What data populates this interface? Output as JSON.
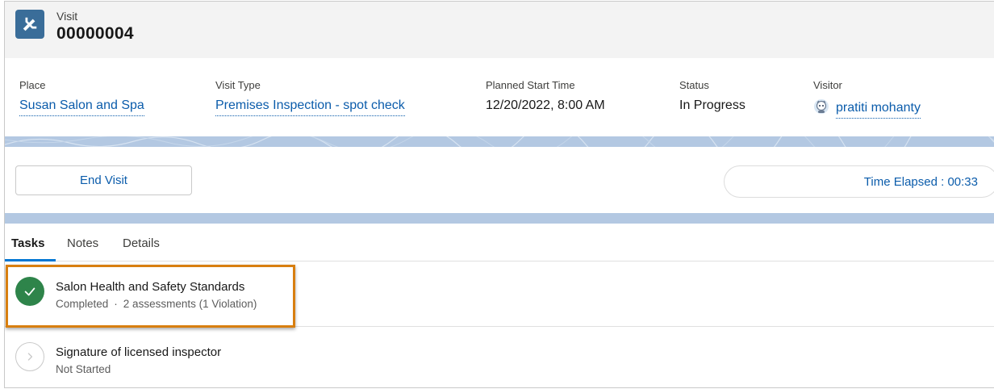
{
  "record": {
    "object_label": "Visit",
    "name": "00000004",
    "icon": "wrench-icon",
    "icon_color": "#3a6d99"
  },
  "highlights": {
    "place": {
      "label": "Place",
      "value": "Susan Salon and Spa"
    },
    "visit_type": {
      "label": "Visit Type",
      "value": "Premises Inspection - spot check"
    },
    "planned_start": {
      "label": "Planned Start Time",
      "value": "12/20/2022, 8:00 AM"
    },
    "status": {
      "label": "Status",
      "value": "In Progress"
    },
    "visitor": {
      "label": "Visitor",
      "value": "pratiti mohanty",
      "avatar": "astro-avatar-icon"
    }
  },
  "actions": {
    "end_visit_label": "End Visit",
    "time_elapsed": "Time Elapsed : 00:33"
  },
  "tabs": [
    {
      "label": "Tasks",
      "active": true
    },
    {
      "label": "Notes",
      "active": false
    },
    {
      "label": "Details",
      "active": false
    }
  ],
  "tasks": [
    {
      "title": "Salon Health and Safety Standards",
      "status": "Completed",
      "separator": "·",
      "detail": "2 assessments (1 Violation)",
      "icon": "check-icon"
    },
    {
      "title": "Signature of licensed inspector",
      "status": "Not Started",
      "icon": "chevron-right-icon"
    }
  ],
  "colors": {
    "link": "#0b5cab",
    "success": "#2e844a",
    "highlight_box": "#d87f10",
    "band": "#b3c8e2",
    "active_tab": "#0176d3"
  }
}
